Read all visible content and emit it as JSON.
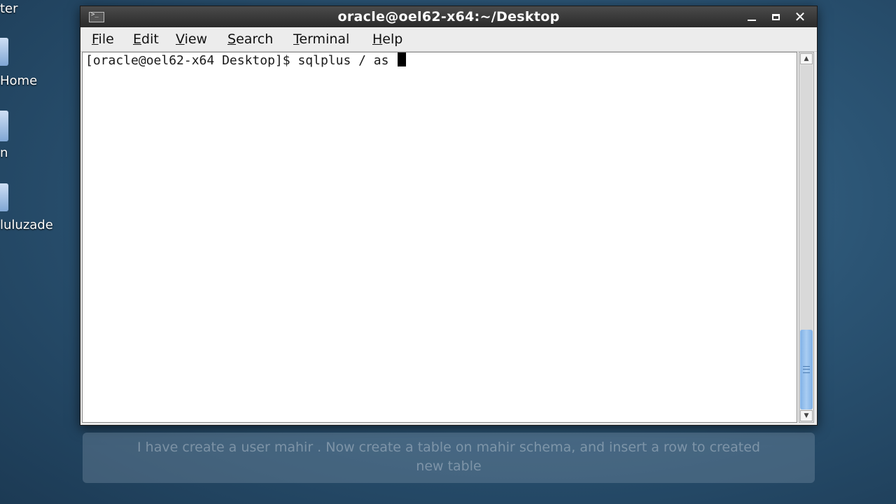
{
  "desktop": {
    "icons": [
      {
        "label": "ter"
      },
      {
        "label": "Home"
      },
      {
        "label": "n"
      },
      {
        "label": "luluzade"
      }
    ]
  },
  "window": {
    "title": "oracle@oel62-x64:~/Desktop",
    "icon": "terminal-icon",
    "controls": {
      "minimize": "minimize-icon",
      "maximize": "maximize-icon",
      "close": "✕"
    }
  },
  "menu": [
    {
      "acc": "F",
      "rest": "ile"
    },
    {
      "acc": "E",
      "rest": "dit"
    },
    {
      "acc": "V",
      "rest": "iew"
    },
    {
      "acc": "S",
      "rest": "earch"
    },
    {
      "acc": "T",
      "rest": "erminal"
    },
    {
      "acc": "H",
      "rest": "elp"
    }
  ],
  "terminal": {
    "prompt": "[oracle@oel62-x64 Desktop]$ ",
    "command": "sqlplus / as "
  },
  "scrollbar": {
    "up": "▲",
    "down": "▼"
  },
  "caption": {
    "line1": "I have create a user mahir . Now create a table on mahir schema, and insert a row to created",
    "line2": "new table"
  }
}
